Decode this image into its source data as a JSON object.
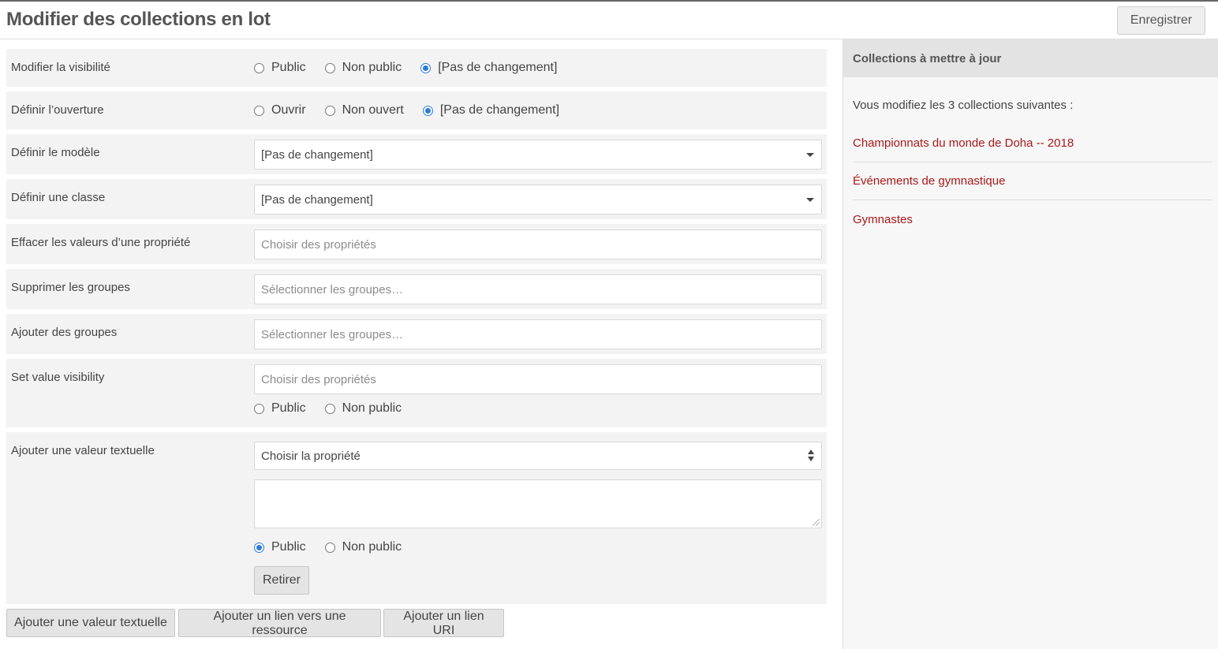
{
  "header": {
    "title": "Modifier des collections en lot",
    "save_label": "Enregistrer"
  },
  "form": {
    "visibility": {
      "label": "Modifier la visibilité",
      "options": [
        "Public",
        "Non public",
        "[Pas de changement]"
      ],
      "selected": "[Pas de changement]"
    },
    "open": {
      "label": "Définir l’ouverture",
      "options": [
        "Ouvrir",
        "Non ouvert",
        "[Pas de changement]"
      ],
      "selected": "[Pas de changement]"
    },
    "template": {
      "label": "Définir le modèle",
      "value": "[Pas de changement]"
    },
    "class": {
      "label": "Définir une classe",
      "value": "[Pas de changement]"
    },
    "clear_values": {
      "label": "Effacer les valeurs d’une propriété",
      "placeholder": "Choisir des propriétés"
    },
    "remove_groups": {
      "label": "Supprimer les groupes",
      "placeholder": "Sélectionner les groupes…"
    },
    "add_groups": {
      "label": "Ajouter des groupes",
      "placeholder": "Sélectionner les groupes…"
    },
    "value_visibility": {
      "label": "Set value visibility",
      "placeholder": "Choisir des propriétés",
      "options": [
        "Public",
        "Non public"
      ],
      "selected": ""
    },
    "add_text_value": {
      "label": "Ajouter une valeur textuelle",
      "property_value": "Choisir la propriété",
      "text_value": "",
      "options": [
        "Public",
        "Non public"
      ],
      "selected": "Public",
      "remove_label": "Retirer"
    },
    "buttons": {
      "add_text": "Ajouter une valeur textuelle",
      "add_resource_link": "Ajouter un lien vers une ressource",
      "add_uri_link": "Ajouter un lien URI"
    }
  },
  "sidebar": {
    "title": "Collections à mettre à jour",
    "intro": "Vous modifiez les 3 collections suivantes :",
    "collections": [
      "Championnats du monde de Doha -- 2018",
      "Événements de gymnastique",
      "Gymnastes"
    ]
  },
  "colors": {
    "link": "#a91919",
    "radio_checked": "#2e7bd6",
    "row_bg": "#f3f3f3"
  }
}
